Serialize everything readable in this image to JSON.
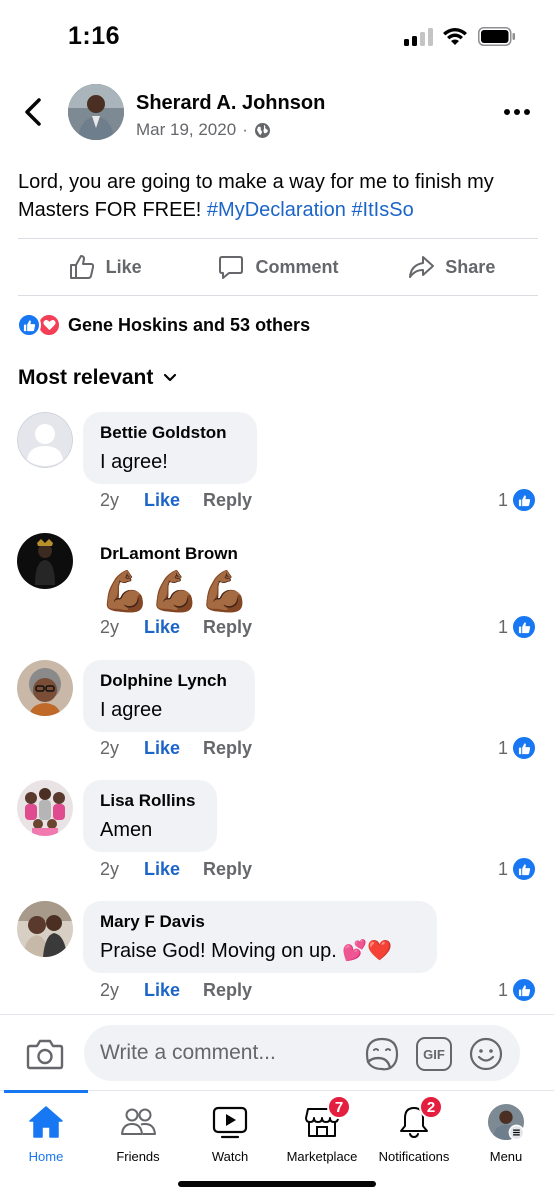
{
  "status_bar": {
    "time": "1:16"
  },
  "post": {
    "author": "Sherard A. Johnson",
    "date": "Mar 19, 2020",
    "separator": "·",
    "text": "Lord, you are going to make a way for me to finish my Masters FOR FREE!",
    "hashtags": [
      "#MyDeclaration",
      "#ItIsSo"
    ],
    "actions": {
      "like": "Like",
      "comment": "Comment",
      "share": "Share"
    },
    "reactions_summary": "Gene Hoskins and 53 others"
  },
  "sort_label": "Most relevant",
  "comments": [
    {
      "name": "Bettie Goldston",
      "text": "I agree!",
      "time": "2y",
      "like": "Like",
      "reply": "Reply",
      "reactions": "1"
    },
    {
      "name": "DrLamont Brown",
      "text": "💪🏾💪🏾💪🏾",
      "time": "2y",
      "like": "Like",
      "reply": "Reply",
      "reactions": "1"
    },
    {
      "name": "Dolphine Lynch",
      "text": "I agree",
      "time": "2y",
      "like": "Like",
      "reply": "Reply",
      "reactions": "1"
    },
    {
      "name": "Lisa Rollins",
      "text": "Amen",
      "time": "2y",
      "like": "Like",
      "reply": "Reply",
      "reactions": "1"
    },
    {
      "name": "Mary F Davis",
      "text": "Praise God! Moving on up. 💕❤️",
      "time": "2y",
      "like": "Like",
      "reply": "Reply",
      "reactions": "1"
    }
  ],
  "composer": {
    "placeholder": "Write a comment...",
    "gif_label": "GIF"
  },
  "tabs": [
    {
      "label": "Home",
      "icon": "home-icon",
      "active": true
    },
    {
      "label": "Friends",
      "icon": "friends-icon"
    },
    {
      "label": "Watch",
      "icon": "watch-icon"
    },
    {
      "label": "Marketplace",
      "icon": "marketplace-icon",
      "badge": "7"
    },
    {
      "label": "Notifications",
      "icon": "bell-icon",
      "badge": "2"
    },
    {
      "label": "Menu",
      "icon": "menu-avatar-icon"
    }
  ],
  "colors": {
    "accent": "#1877f2",
    "link": "#1c65c8",
    "badge": "#e41e3f",
    "bubble": "#f0f2f5",
    "secondary_text": "#65676b"
  }
}
